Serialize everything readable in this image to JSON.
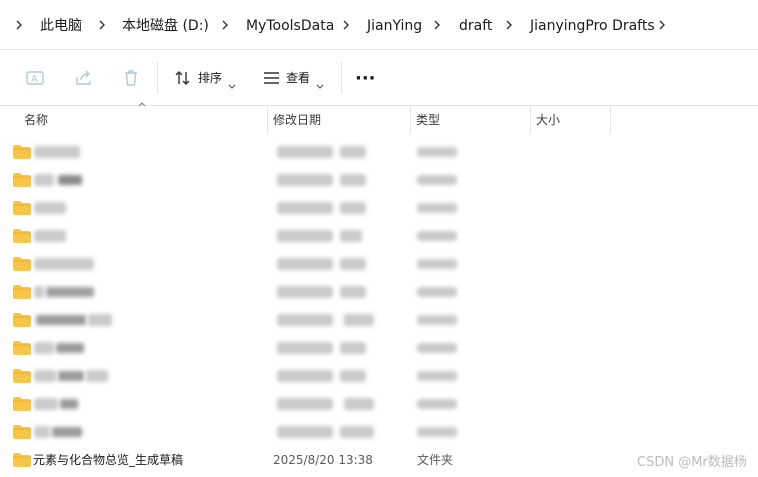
{
  "breadcrumb": {
    "items": [
      {
        "label": "此电脑"
      },
      {
        "label": "本地磁盘 (D:)"
      },
      {
        "label": "MyToolsData"
      },
      {
        "label": "JianYing"
      },
      {
        "label": "draft"
      },
      {
        "label": "JianyingPro Drafts"
      }
    ]
  },
  "toolbar": {
    "sort_label": "排序",
    "view_label": "查看",
    "more_label": "···"
  },
  "columns": {
    "name": "名称",
    "date": "修改日期",
    "type": "类型",
    "size": "大小"
  },
  "files": [
    {
      "name": "元素与化合物总览_生成草稿",
      "modified": "2025/8/20 13:38",
      "type": "文件夹",
      "size": ""
    }
  ],
  "watermark": "CSDN @Mr数据杨",
  "colors": {
    "folder": "#f7c54a",
    "folder_dark": "#e8ad24",
    "icon_disabled": "#b8c6d6",
    "blurred": "#c9c9c9"
  }
}
